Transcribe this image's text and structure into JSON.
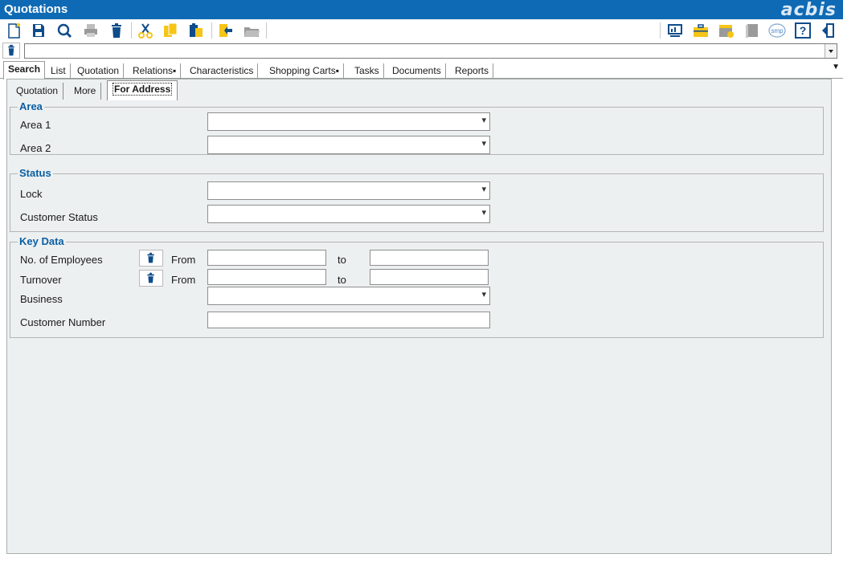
{
  "app": {
    "title": "Quotations",
    "brand": "acbis"
  },
  "toolbar": {
    "left_icons": [
      "new-icon",
      "save-icon",
      "search-icon",
      "print-icon",
      "delete-icon",
      "cut-icon",
      "copy-icon",
      "paste-icon",
      "import-icon",
      "open-folder-icon"
    ],
    "right_icons": [
      "monitor-icon",
      "briefcase-icon",
      "calendar-icon",
      "book-icon",
      "smp-icon",
      "help-icon",
      "exit-icon"
    ],
    "smp_label": "smp",
    "help_label": "?"
  },
  "main_tabs": [
    "Search",
    "List",
    "Quotation",
    "Relations▪",
    "Characteristics",
    "Shopping Carts▪",
    "Tasks",
    "Documents",
    "Reports"
  ],
  "sub_tabs": [
    "Quotation",
    "More",
    "For Address"
  ],
  "area": {
    "title": "Area",
    "area1_label": "Area 1",
    "area2_label": "Area 2",
    "area1_value": "",
    "area2_value": ""
  },
  "status": {
    "title": "Status",
    "lock_label": "Lock",
    "customer_status_label": "Customer Status",
    "lock_value": "",
    "customer_status_value": ""
  },
  "key_data": {
    "title": "Key Data",
    "employees_label": "No. of Employees",
    "turnover_label": "Turnover",
    "business_label": "Business",
    "customer_number_label": "Customer Number",
    "from_label": "From",
    "to_label": "to",
    "employees_from": "",
    "employees_to": "",
    "turnover_from": "",
    "turnover_to": "",
    "business_value": "",
    "customer_number_value": ""
  },
  "colors": {
    "titlebar": "#0e6ab4",
    "accent": "#0a5fa3",
    "panel_bg": "#edf0f0",
    "icon_yellow": "#f5c518",
    "icon_blue": "#0e4c8a"
  }
}
